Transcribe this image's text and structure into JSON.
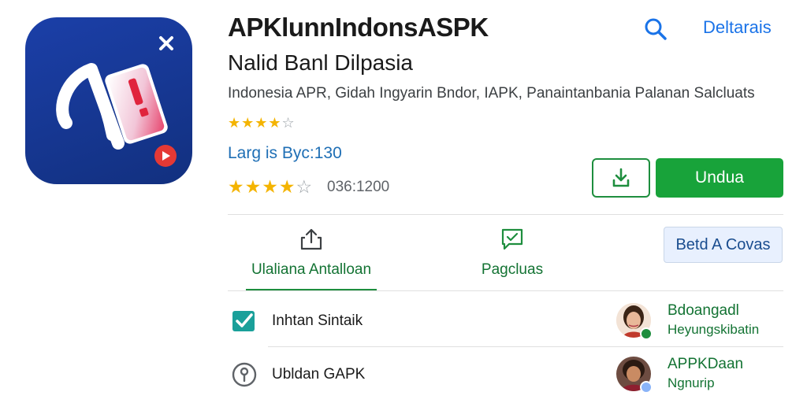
{
  "app": {
    "title": "APKlunnIndonsASPK",
    "developer": "Nalid Banl Dilpasia",
    "category_line": "Indonesia APR, Gidah Ingyarin Bndor, IAPK, Panaintanbania Palanan Salcluats",
    "version_line": "Larg is Byc:130",
    "review_count": "036:1200",
    "rating_top": {
      "filled": "★★★★",
      "empty": "☆"
    },
    "rating_bottom": {
      "filled": "★★★★",
      "empty": "☆"
    },
    "icon_name": "app-logo-icon"
  },
  "header": {
    "details_label": "Deltarais",
    "search_icon": "search-icon"
  },
  "actions": {
    "install_label": "Undua",
    "download_icon": "download-icon",
    "tab1_label": "Ulaliana Antalloan",
    "tab1_icon": "share-icon",
    "tab2_label": "Pagcluas",
    "tab2_icon": "message-icon",
    "side_button_label": "Betd A Covas"
  },
  "list": [
    {
      "label": "Inhtan Sintaik",
      "icon": "checkbox-checked-icon",
      "user_name": "Bdoangadl",
      "user_sub": "Heyungskibatin"
    },
    {
      "label": "Ubldan GAPK",
      "icon": "info-circle-icon",
      "user_name": "APPKDaan",
      "user_sub": "Ngnurip"
    }
  ],
  "colors": {
    "brand_blue": "#12307f",
    "accent_green": "#18a33a",
    "link_blue": "#1a73e8",
    "star_yellow": "#f4b400"
  }
}
